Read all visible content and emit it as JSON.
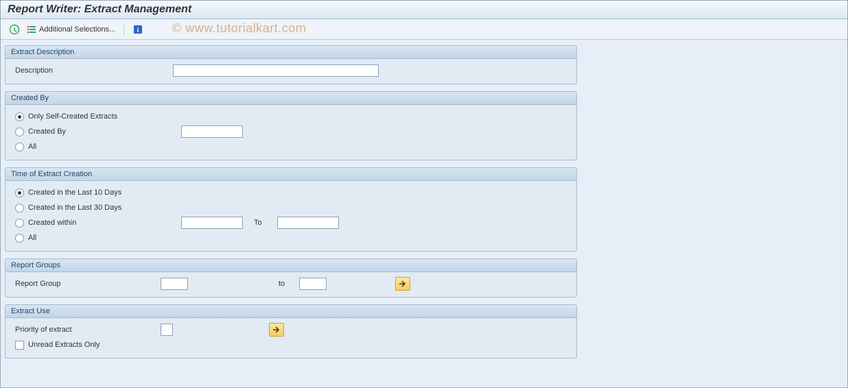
{
  "title": "Report Writer: Extract Management",
  "watermark": "© www.tutorialkart.com",
  "toolbar": {
    "additional_selections": "Additional Selections..."
  },
  "groups": {
    "extract_description": {
      "title": "Extract Description",
      "description_label": "Description"
    },
    "created_by": {
      "title": "Created By",
      "opt_self": "Only Self-Created Extracts",
      "opt_created_by": "Created By",
      "opt_all": "All"
    },
    "time_creation": {
      "title": "Time of Extract Creation",
      "opt_last10": "Created in the Last 10 Days",
      "opt_last30": "Created in the Last 30 Days",
      "opt_within": "Created within",
      "to_label": "To",
      "opt_all": "All"
    },
    "report_groups": {
      "title": "Report Groups",
      "label": "Report Group",
      "to_label": "to"
    },
    "extract_use": {
      "title": "Extract Use",
      "priority_label": "Priority of extract",
      "unread_label": "Unread Extracts Only"
    }
  }
}
